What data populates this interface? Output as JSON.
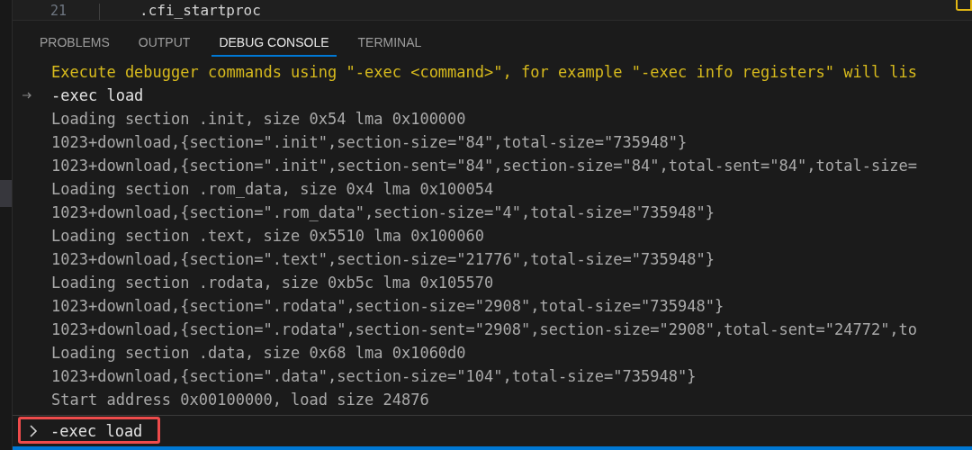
{
  "editor": {
    "line_number": "21",
    "code": ".cfi_startproc"
  },
  "tabs": [
    {
      "label": "PROBLEMS",
      "selected": false
    },
    {
      "label": "OUTPUT",
      "selected": false
    },
    {
      "label": "DEBUG CONSOLE",
      "selected": true
    },
    {
      "label": "TERMINAL",
      "selected": false
    }
  ],
  "console": [
    {
      "kind": "info",
      "text": "Execute debugger commands using \"-exec <command>\", for example \"-exec info registers\" will lis"
    },
    {
      "kind": "input",
      "text": "-exec load"
    },
    {
      "kind": "output",
      "text": "Loading section .init, size 0x54 lma 0x100000"
    },
    {
      "kind": "output",
      "text": "1023+download,{section=\".init\",section-size=\"84\",total-size=\"735948\"}"
    },
    {
      "kind": "output",
      "text": "1023+download,{section=\".init\",section-sent=\"84\",section-size=\"84\",total-sent=\"84\",total-size="
    },
    {
      "kind": "output",
      "text": "Loading section .rom_data, size 0x4 lma 0x100054"
    },
    {
      "kind": "output",
      "text": "1023+download,{section=\".rom_data\",section-size=\"4\",total-size=\"735948\"}"
    },
    {
      "kind": "output",
      "text": "Loading section .text, size 0x5510 lma 0x100060"
    },
    {
      "kind": "output",
      "text": "1023+download,{section=\".text\",section-size=\"21776\",total-size=\"735948\"}"
    },
    {
      "kind": "output",
      "text": "Loading section .rodata, size 0xb5c lma 0x105570"
    },
    {
      "kind": "output",
      "text": "1023+download,{section=\".rodata\",section-size=\"2908\",total-size=\"735948\"}"
    },
    {
      "kind": "output",
      "text": "1023+download,{section=\".rodata\",section-sent=\"2908\",section-size=\"2908\",total-sent=\"24772\",to"
    },
    {
      "kind": "output",
      "text": "Loading section .data, size 0x68 lma 0x1060d0"
    },
    {
      "kind": "output",
      "text": "1023+download,{section=\".data\",section-size=\"104\",total-size=\"735948\"}"
    },
    {
      "kind": "output",
      "text": "Start address 0x00100000, load size 24876"
    }
  ],
  "input": {
    "value": "-exec load"
  }
}
